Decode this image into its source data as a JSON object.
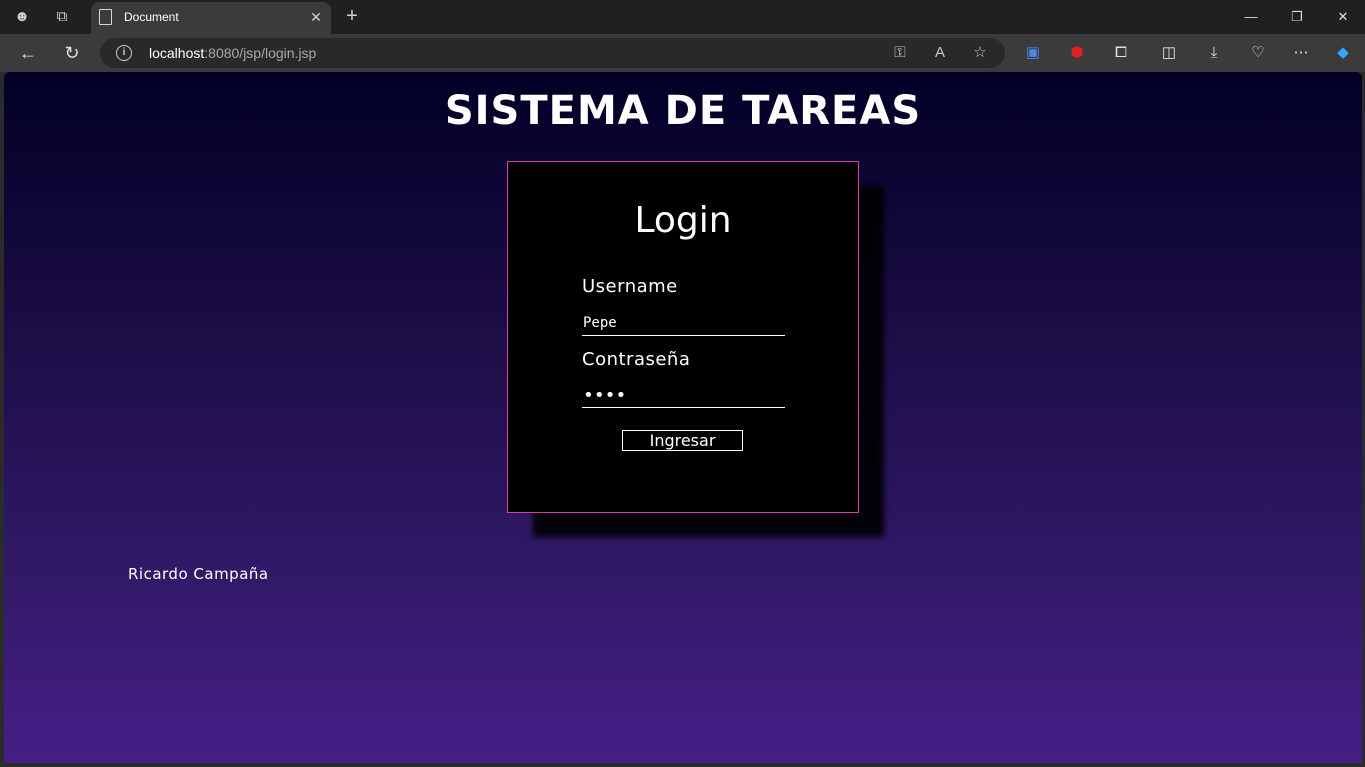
{
  "browser": {
    "tab_title": "Document",
    "url_host": "localhost",
    "url_rest": ":8080/jsp/login.jsp",
    "icons": [
      "profile-icon",
      "workspaces-icon",
      "new-tab-icon",
      "back-icon",
      "refresh-icon",
      "info-icon",
      "key-icon",
      "read-aloud-icon",
      "favorite-star-icon",
      "translate-icon",
      "adblock-icon",
      "extensions-icon",
      "split-screen-icon",
      "downloads-icon",
      "health-icon",
      "more-icon",
      "copilot-icon"
    ]
  },
  "page": {
    "heading": "SISTEMA DE TAREAS",
    "login": {
      "title": "Login",
      "username_label": "Username",
      "username_value": "Pepe",
      "password_label": "Contraseña",
      "password_value": "pepe",
      "submit_label": "Ingresar"
    },
    "footer_author": "Ricardo Campaña"
  },
  "colors": {
    "gradient_top": "#010026",
    "gradient_bottom": "#471e87",
    "card_border": "#d63fa4",
    "card_bg": "#000000"
  }
}
